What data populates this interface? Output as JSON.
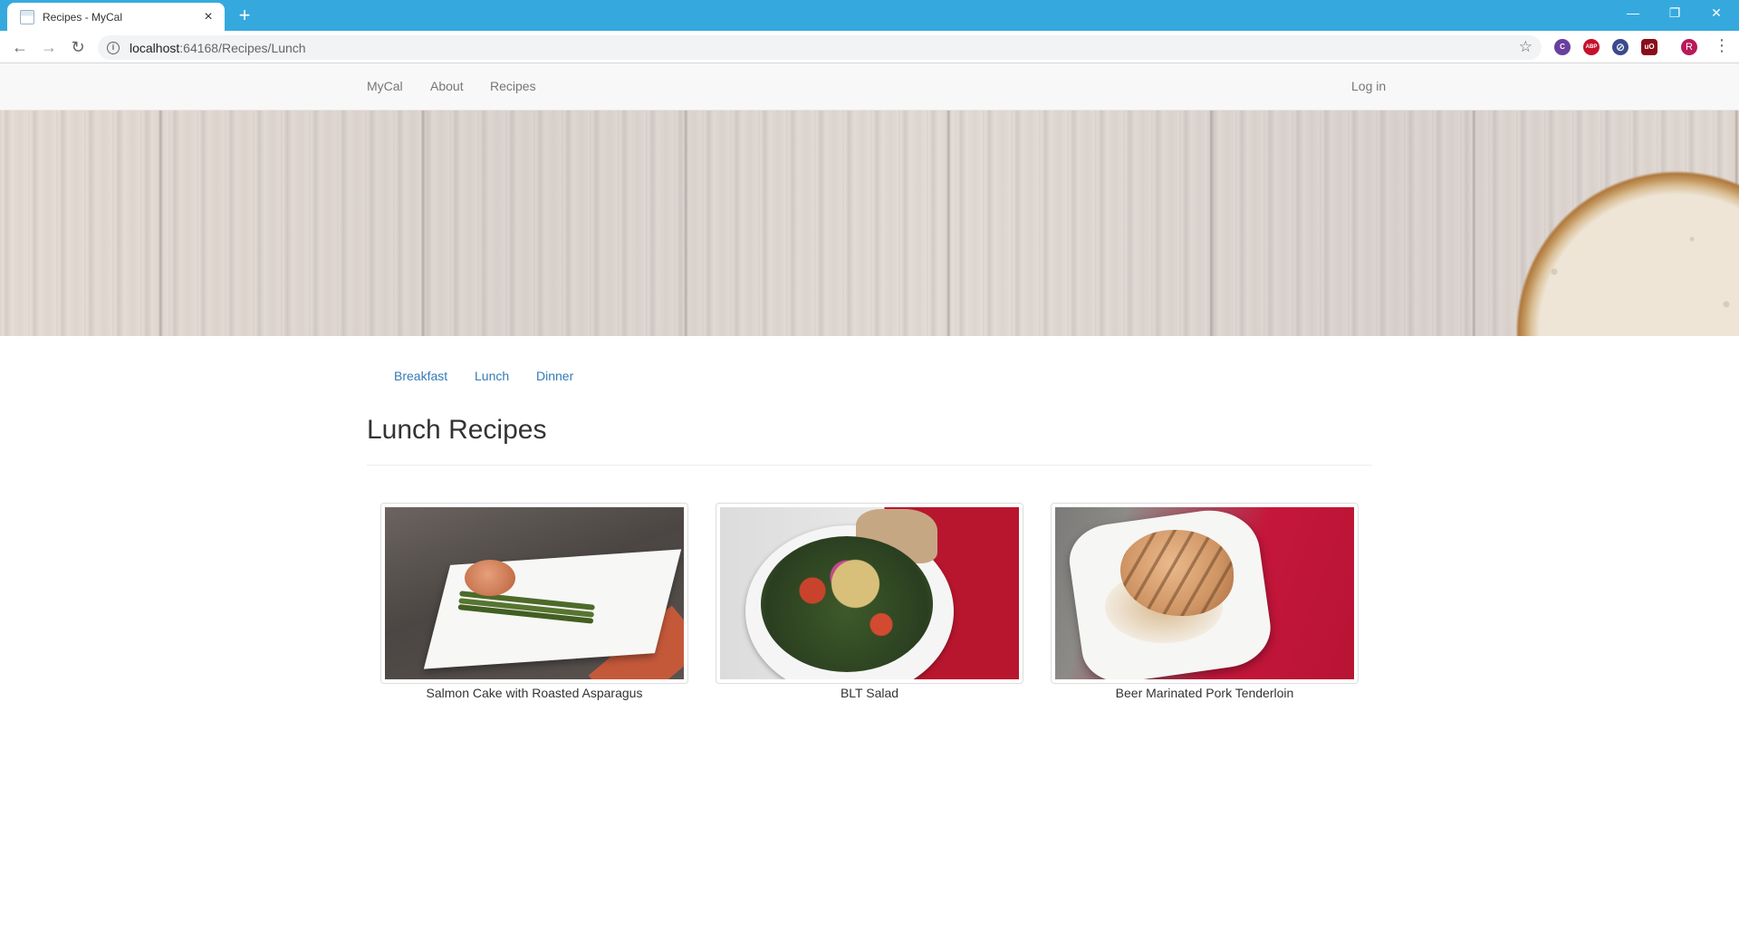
{
  "browser": {
    "tab_title": "Recipes - MyCal",
    "tab_close": "×",
    "new_tab": "+",
    "url_host": "localhost",
    "url_path": ":64168/Recipes/Lunch",
    "profile_initial": "R",
    "extensions": [
      {
        "name": "c-extension-icon",
        "label": "C",
        "color": "#6a3fa0"
      },
      {
        "name": "adblock-plus-icon",
        "label": "ABP",
        "color": "#c6102b"
      },
      {
        "name": "block-extension-icon",
        "label": "⊘",
        "color": "#3a4b8c"
      },
      {
        "name": "ublock-origin-icon",
        "label": "uO",
        "color": "#8a0d1a"
      }
    ]
  },
  "navbar": {
    "brand": "MyCal",
    "about": "About",
    "recipes": "Recipes",
    "login": "Log in"
  },
  "subnav": {
    "items": [
      "Breakfast",
      "Lunch",
      "Dinner"
    ]
  },
  "page": {
    "title": "Lunch Recipes"
  },
  "recipes": [
    {
      "title": "Salmon Cake with Roasted Asparagus"
    },
    {
      "title": "BLT Salad"
    },
    {
      "title": "Beer Marinated Pork Tenderloin"
    }
  ]
}
